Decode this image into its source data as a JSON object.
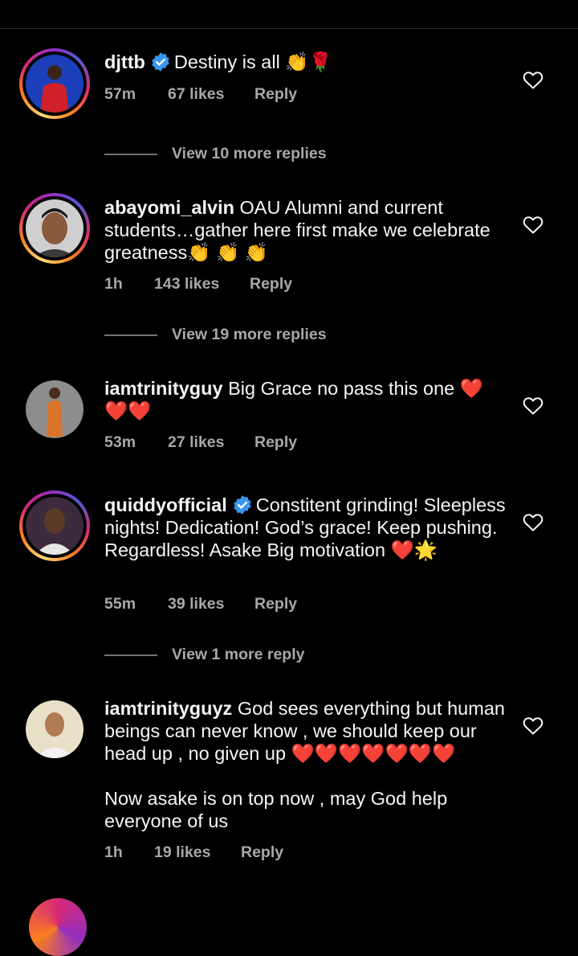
{
  "comments": [
    {
      "username": "djttb",
      "verified": true,
      "text": "Destiny is all 👏🌹",
      "time": "57m",
      "likes": "67 likes",
      "reply": "Reply",
      "view_more": "View 10 more replies",
      "avatar": "red-outfit-avatar"
    },
    {
      "username": "abayomi_alvin",
      "verified": false,
      "text": "OAU Alumni and current students…gather here first make we celebrate greatness👏 👏 👏",
      "time": "1h",
      "likes": "143 likes",
      "reply": "Reply",
      "view_more": "View 19 more replies",
      "avatar": "portrait-avatar"
    },
    {
      "username": "iamtrinityguy",
      "verified": false,
      "text": "Big Grace no pass this one ❤️❤️❤️",
      "time": "53m",
      "likes": "27 likes",
      "reply": "Reply",
      "avatar": "orange-outfit-avatar"
    },
    {
      "username": "quiddyofficial",
      "verified": true,
      "text": "Constitent grinding!  Sleepless nights!  Dedication!  God’s grace!  Keep pushing.  Regardless!  Asake Big motivation ❤️🌟",
      "time": "55m",
      "likes": "39 likes",
      "reply": "Reply",
      "view_more": "View 1 more reply",
      "avatar": "white-shirt-avatar"
    },
    {
      "username": "iamtrinityguyz",
      "verified": false,
      "text": "God sees everything but human beings can never know , we should keep our head up , no given up ❤️❤️❤️❤️❤️❤️❤️",
      "text2": "Now asake is on top now , may God help everyone of us",
      "time": "1h",
      "likes": "19 likes",
      "reply": "Reply",
      "avatar": "light-background-avatar"
    }
  ],
  "colors": {
    "background": "#000000",
    "text": "#f5f5f5",
    "secondary": "#a8a8a8",
    "verified": "#3797f0",
    "heart": "#e0262f"
  },
  "icons": {
    "like": "heart-outline-icon",
    "verified": "verified-badge-icon"
  }
}
